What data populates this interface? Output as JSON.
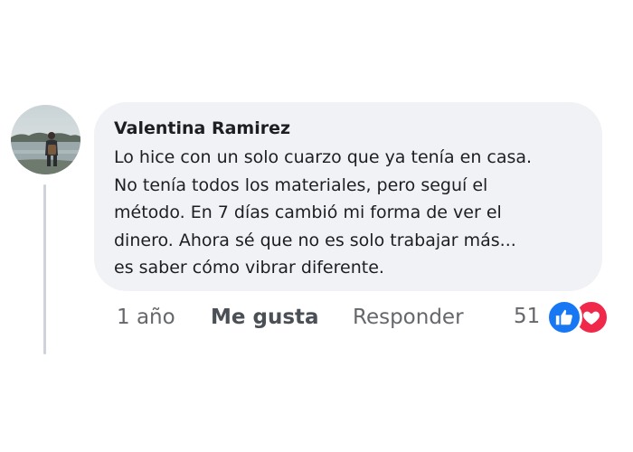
{
  "comment": {
    "author": "Valentina Ramirez",
    "text_lines": [
      "Lo hice con un solo cuarzo que ya tenía en casa.",
      "No tenía todos los materiales, pero seguí el",
      "método. En 7 días cambió mi forma de ver el",
      "dinero. Ahora sé que no es solo trabajar más...",
      "es saber cómo vibrar diferente."
    ],
    "avatar_icon": "avatar-photo"
  },
  "actions": {
    "time": "1 año",
    "like": "Me gusta",
    "reply": "Responder"
  },
  "reactions": {
    "count": "51",
    "icons": [
      "like-icon",
      "love-icon"
    ],
    "colors": {
      "like": "#1877f2",
      "love": "#f02849"
    }
  },
  "colors": {
    "bubble": "#f0f2f5",
    "secondary_text": "#65676b",
    "primary_text": "#1c1e21"
  }
}
